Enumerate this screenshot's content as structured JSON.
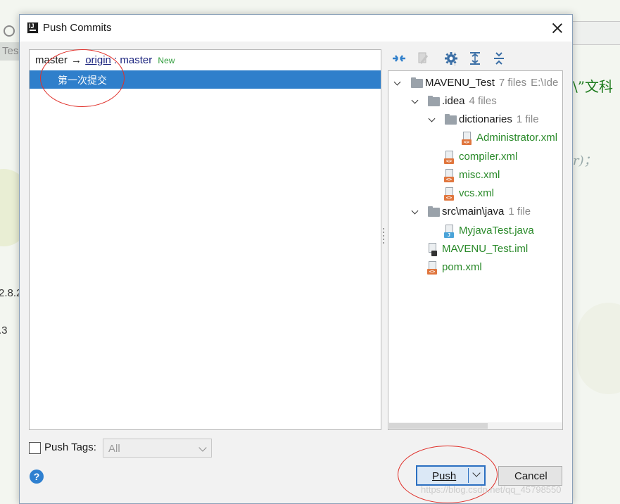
{
  "background": {
    "tab_text": "Tes",
    "num1": "2.8.2",
    "num2": ".3",
    "code_line1": "\\”文科",
    "code_line2": "r)；"
  },
  "dialog": {
    "title": "Push Commits",
    "branch": {
      "local": "master",
      "arrow": "→",
      "remote": "origin",
      "separator": ":",
      "remote_branch": "master",
      "new_badge": "New"
    },
    "commits": [
      {
        "message": "第一次提交"
      }
    ],
    "tree": [
      {
        "name": "MAVENU_Test",
        "count": "7 files",
        "path": "E:\\Ide"
      },
      {
        "name": ".idea",
        "count": "4 files"
      },
      {
        "name": "dictionaries",
        "count": "1 file"
      },
      {
        "name": "Administrator.xml"
      },
      {
        "name": "compiler.xml"
      },
      {
        "name": "misc.xml"
      },
      {
        "name": "vcs.xml"
      },
      {
        "name": "src\\main\\java",
        "count": "1 file"
      },
      {
        "name": "MyjavaTest.java"
      },
      {
        "name": "MAVENU_Test.iml"
      },
      {
        "name": "pom.xml"
      }
    ],
    "push_tags_label": "Push Tags:",
    "tags_select_value": "All",
    "push_label": "Push",
    "cancel_label": "Cancel",
    "help_label": "?"
  },
  "watermark": "https://blog.csdn.net/qq_45798550",
  "colors": {
    "selection": "#2f7fcb",
    "file_green": "#2a8a2a",
    "annotation_red": "#e0302a"
  }
}
